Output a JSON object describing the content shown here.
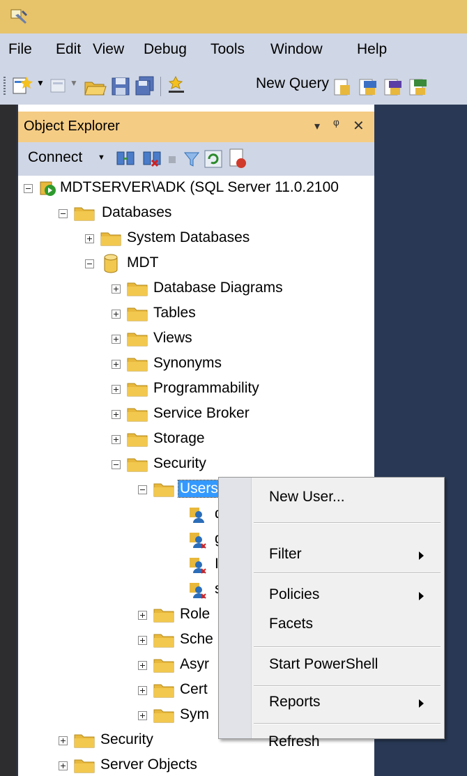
{
  "menubar": {
    "items": [
      "File",
      "Edit",
      "View",
      "Debug",
      "Tools",
      "Window",
      "Help"
    ]
  },
  "toolbar": {
    "new_query_label": "New Query"
  },
  "object_explorer": {
    "title": "Object Explorer",
    "header_buttons": [
      "▾",
      "ᵠ",
      "✕"
    ],
    "connect_label": "Connect"
  },
  "tree": {
    "server": "MDTSERVER\\ADK (SQL Server 11.0.2100",
    "databases": "Databases",
    "system_databases": "System Databases",
    "mdt": "MDT",
    "database_diagrams": "Database Diagrams",
    "tables": "Tables",
    "views": "Views",
    "synonyms": "Synonyms",
    "programmability": "Programmability",
    "service_broker": "Service Broker",
    "storage": "Storage",
    "security": "Security",
    "users": "Users",
    "user1": "d",
    "user2": "g",
    "user3": "I",
    "user4": "s",
    "roles": "Role",
    "schemas": "Sche",
    "asymmetric": "Asyr",
    "certificates": "Cert",
    "symmetric": "Sym",
    "server_security": "Security",
    "server_objects": "Server Objects"
  },
  "context_menu": {
    "new_user": "New User...",
    "filter": "Filter",
    "policies": "Policies",
    "facets": "Facets",
    "start_powershell": "Start PowerShell",
    "reports": "Reports",
    "refresh": "Refresh"
  },
  "colors": {
    "title_bar": "#e7c36a",
    "menu_bg": "#cfd6e5",
    "document_bg": "#293955",
    "panel_header": "#f5cc84",
    "selection": "#3399ff",
    "folder": "#e8b83c"
  }
}
